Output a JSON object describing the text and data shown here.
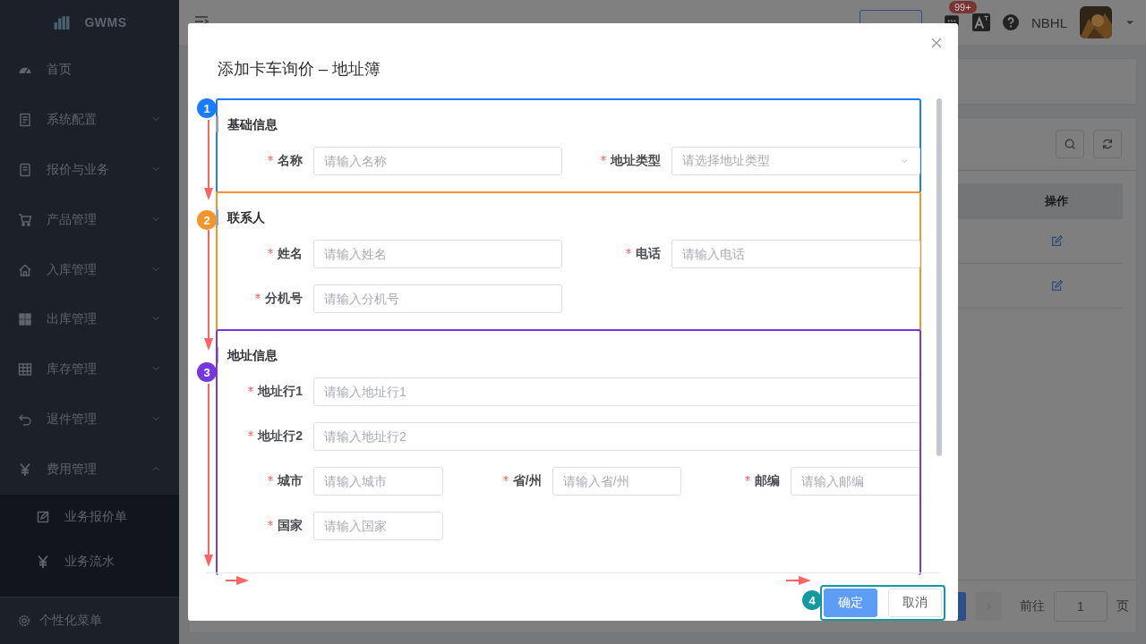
{
  "sidebar": {
    "logo": "GWMS",
    "items": [
      {
        "label": "首页"
      },
      {
        "label": "系统配置",
        "expanded": false
      },
      {
        "label": "报价与业务",
        "expanded": false
      },
      {
        "label": "产品管理",
        "expanded": false
      },
      {
        "label": "入库管理",
        "expanded": false
      },
      {
        "label": "出库管理",
        "expanded": false
      },
      {
        "label": "库存管理",
        "expanded": false
      },
      {
        "label": "退件管理",
        "expanded": false
      },
      {
        "label": "费用管理",
        "expanded": true,
        "children": [
          {
            "label": "业务报价单"
          },
          {
            "label": "业务流水"
          }
        ]
      }
    ],
    "footer": "个性化菜单"
  },
  "header": {
    "badge": "99+",
    "user": "NBHL"
  },
  "table": {
    "columns": [
      "操作"
    ],
    "rows": [
      {
        "kind": "edit"
      },
      {
        "kind": "edit"
      }
    ]
  },
  "pagination": {
    "goto": "前往",
    "page": "1",
    "suffix": "页"
  },
  "dialog": {
    "title": "添加卡车询价 – 地址簿",
    "sections": [
      {
        "badge": "1",
        "color": "#1a7cff",
        "title": "基础信息",
        "rows": [
          [
            {
              "label": "名称",
              "placeholder": "请输入名称",
              "required": true,
              "kind": "input"
            },
            {
              "label": "地址类型",
              "placeholder": "请选择地址类型",
              "required": true,
              "kind": "select"
            }
          ]
        ]
      },
      {
        "badge": "2",
        "color": "#f3952a",
        "title": "联系人",
        "rows": [
          [
            {
              "label": "姓名",
              "placeholder": "请输入姓名",
              "required": true,
              "kind": "input"
            },
            {
              "label": "电话",
              "placeholder": "请输入电话",
              "required": true,
              "kind": "input"
            }
          ],
          [
            {
              "label": "分机号",
              "placeholder": "请输入分机号",
              "required": true,
              "kind": "input"
            },
            null
          ]
        ]
      },
      {
        "badge": "3",
        "color": "#7638dc",
        "title": "地址信息",
        "rows": [
          [
            {
              "label": "地址行1",
              "placeholder": "请输入地址行1",
              "required": true,
              "kind": "input"
            }
          ],
          [
            {
              "label": "地址行2",
              "placeholder": "请输入地址行2",
              "required": true,
              "kind": "input"
            }
          ],
          [
            {
              "label": "城市",
              "placeholder": "请输入城市",
              "required": true,
              "kind": "input"
            },
            {
              "label": "省/州",
              "placeholder": "请输入省/州",
              "required": true,
              "kind": "input"
            },
            {
              "label": "邮编",
              "placeholder": "请输入邮编",
              "required": true,
              "kind": "input"
            }
          ],
          [
            {
              "label": "国家",
              "placeholder": "请输入国家",
              "required": true,
              "kind": "input"
            },
            null,
            null
          ]
        ]
      }
    ],
    "footer": {
      "badge": "4",
      "color": "#129a9e",
      "buttons": [
        {
          "label": "确定",
          "kind": "primary"
        },
        {
          "label": "取消",
          "kind": "default"
        }
      ]
    }
  }
}
